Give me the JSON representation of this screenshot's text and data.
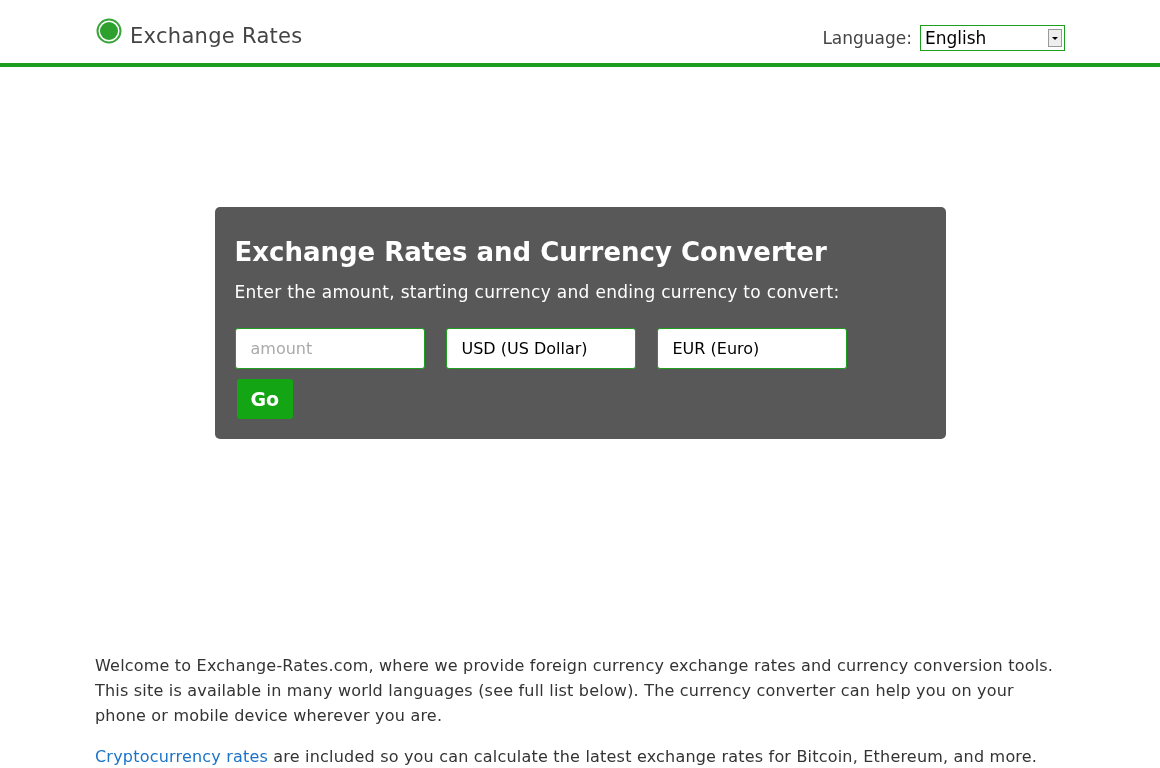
{
  "header": {
    "title": "Exchange Rates",
    "language_label": "Language:",
    "language_value": "English"
  },
  "converter": {
    "title": "Exchange Rates and Currency Converter",
    "instructions": "Enter the amount, starting currency and ending currency to convert:",
    "fields": [
      {
        "kind": "input",
        "placeholder": "amount"
      },
      {
        "kind": "select",
        "value": "USD (US Dollar)"
      },
      {
        "kind": "select",
        "value": "EUR (Euro)"
      }
    ],
    "button": "Go"
  },
  "intro": "Welcome to Exchange-Rates.com, where we provide foreign currency exchange rates and currency conversion tools. This site is available in many world languages (see full list below). The currency converter can help you on your phone or mobile device wherever you are.",
  "crypto": {
    "link": "Cryptocurrency rates",
    "text": " are included so you can calculate the latest exchange rates for Bitcoin, Ethereum, and more."
  }
}
